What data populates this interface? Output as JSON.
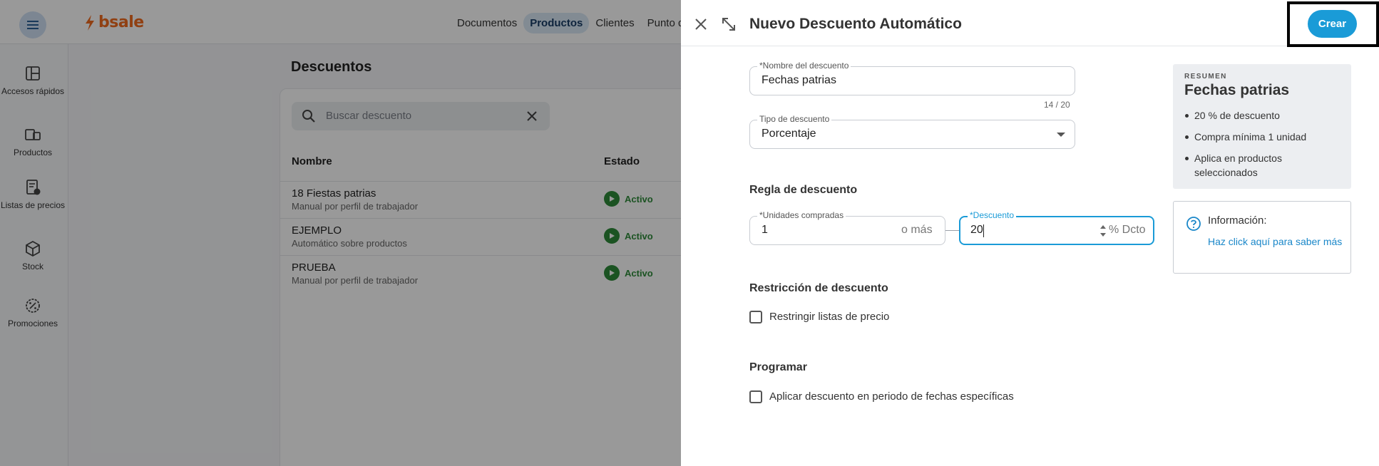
{
  "app": {
    "logo_text": "bsale",
    "topnav": [
      "Documentos",
      "Productos",
      "Clientes",
      "Punto de"
    ],
    "topnav_active": "Productos",
    "sidebar": [
      {
        "label": "Accesos rápidos",
        "icon": "grid-icon"
      },
      {
        "label": "Productos",
        "icon": "devices-icon"
      },
      {
        "label": "Listas de precios",
        "icon": "price-list-icon"
      },
      {
        "label": "Stock",
        "icon": "box-icon"
      },
      {
        "label": "Promociones",
        "icon": "discount-badge-icon"
      }
    ],
    "page_title": "Descuentos",
    "search_placeholder": "Buscar descuento",
    "table": {
      "headers": [
        "Nombre",
        "Estado"
      ],
      "rows": [
        {
          "name": "18 Fiestas patrias",
          "sub": "Manual por perfil de trabajador",
          "status": "Activo"
        },
        {
          "name": "EJEMPLO",
          "sub": "Automático sobre productos",
          "status": "Activo"
        },
        {
          "name": "PRUEBA",
          "sub": "Manual por perfil de trabajador",
          "status": "Activo"
        }
      ]
    },
    "accent_color": "#1a9bd7",
    "active_color": "#2e8b3a",
    "brand_color": "#f06b1f"
  },
  "drawer": {
    "title": "Nuevo Descuento Automático",
    "create_label": "Crear",
    "name_field": {
      "label": "*Nombre del descuento",
      "value": "Fechas patrias",
      "counter": "14 / 20"
    },
    "type_field": {
      "label": "Tipo de descuento",
      "value": "Porcentaje"
    },
    "rule_section": "Regla de descuento",
    "units_field": {
      "label": "*Unidades compradas",
      "value": "1",
      "suffix": "o más"
    },
    "discount_field": {
      "label": "*Descuento",
      "value": "20",
      "suffix": "% Dcto"
    },
    "restriction_section": "Restricción de descuento",
    "restrict_checkbox": "Restringir listas de precio",
    "schedule_section": "Programar",
    "schedule_checkbox": "Aplicar descuento en periodo de fechas específicas",
    "summary": {
      "kicker": "RESUMEN",
      "title": "Fechas patrias",
      "items": [
        "20 % de descuento",
        "Compra mínima 1 unidad",
        "Aplica en productos seleccionados"
      ]
    },
    "info": {
      "title": "Información:",
      "link": "Haz click aquí para saber más"
    }
  }
}
